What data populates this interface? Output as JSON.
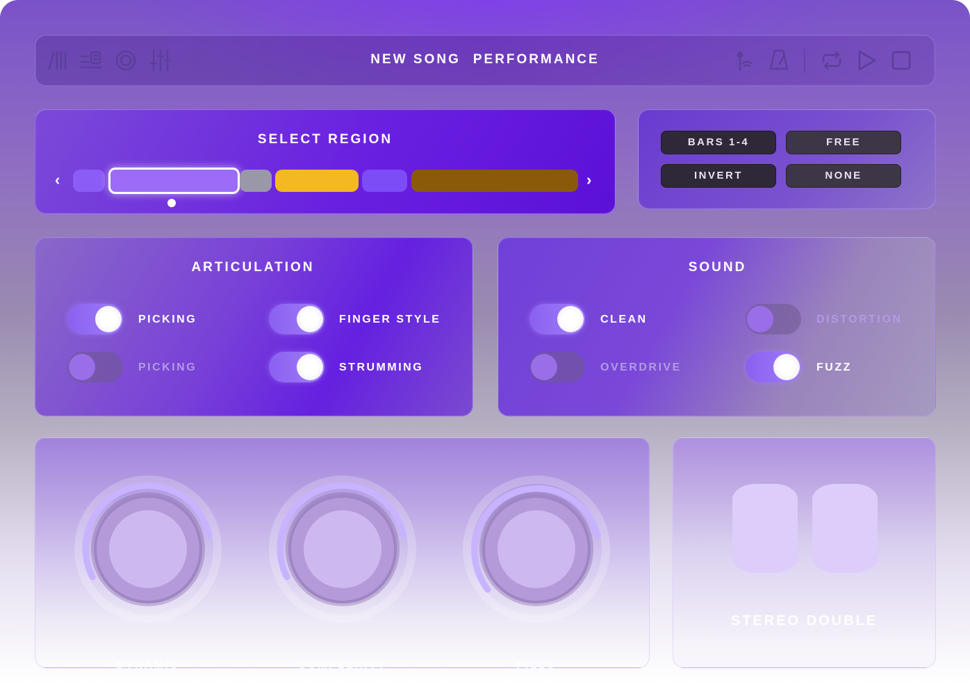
{
  "topbar": {
    "title_left": "NEW SONG",
    "title_right": "PERFORMANCE",
    "left_icons": [
      "tracks-icon",
      "score-icon",
      "loop-icon",
      "mixer-icon"
    ],
    "right_icons": [
      "tuner-icon",
      "metronome-icon",
      "cycle-icon",
      "play-icon",
      "stop-icon"
    ]
  },
  "region": {
    "title": "SELECT REGION",
    "segments": [
      {
        "color": "#8b5cf6"
      },
      {
        "color": "#9c6cf8",
        "selected": true
      },
      {
        "color": "#9a98a8"
      },
      {
        "color": "#f4b820"
      },
      {
        "color": "#7c4cf6"
      },
      {
        "color": "#8a5a0a"
      }
    ]
  },
  "options": {
    "buttons": [
      "BARS 1-4",
      "FREE",
      "INVERT",
      "NONE"
    ]
  },
  "articulation": {
    "title": "ARTICULATION",
    "toggles": [
      {
        "label": "PICKING",
        "on": true
      },
      {
        "label": "FINGER STYLE",
        "on": true
      },
      {
        "label": "PICKING",
        "on": false
      },
      {
        "label": "STRUMMING",
        "on": true
      }
    ]
  },
  "sound": {
    "title": "SOUND",
    "toggles": [
      {
        "label": "CLEAN",
        "on": true
      },
      {
        "label": "DISTORTION",
        "on": false
      },
      {
        "label": "OVERDRIVE",
        "on": false
      },
      {
        "label": "FUZZ",
        "on": true
      }
    ]
  },
  "knobs": [
    {
      "label": "DYNAMIC"
    },
    {
      "label": "COMPLEXITY"
    },
    {
      "label": "FILLS"
    }
  ],
  "stereo": {
    "label": "STEREO DOUBLE"
  },
  "colors": {
    "accent": "#7c3aed",
    "toggle_on": "#a07ef8",
    "toggle_off": "#6e5a8c"
  }
}
